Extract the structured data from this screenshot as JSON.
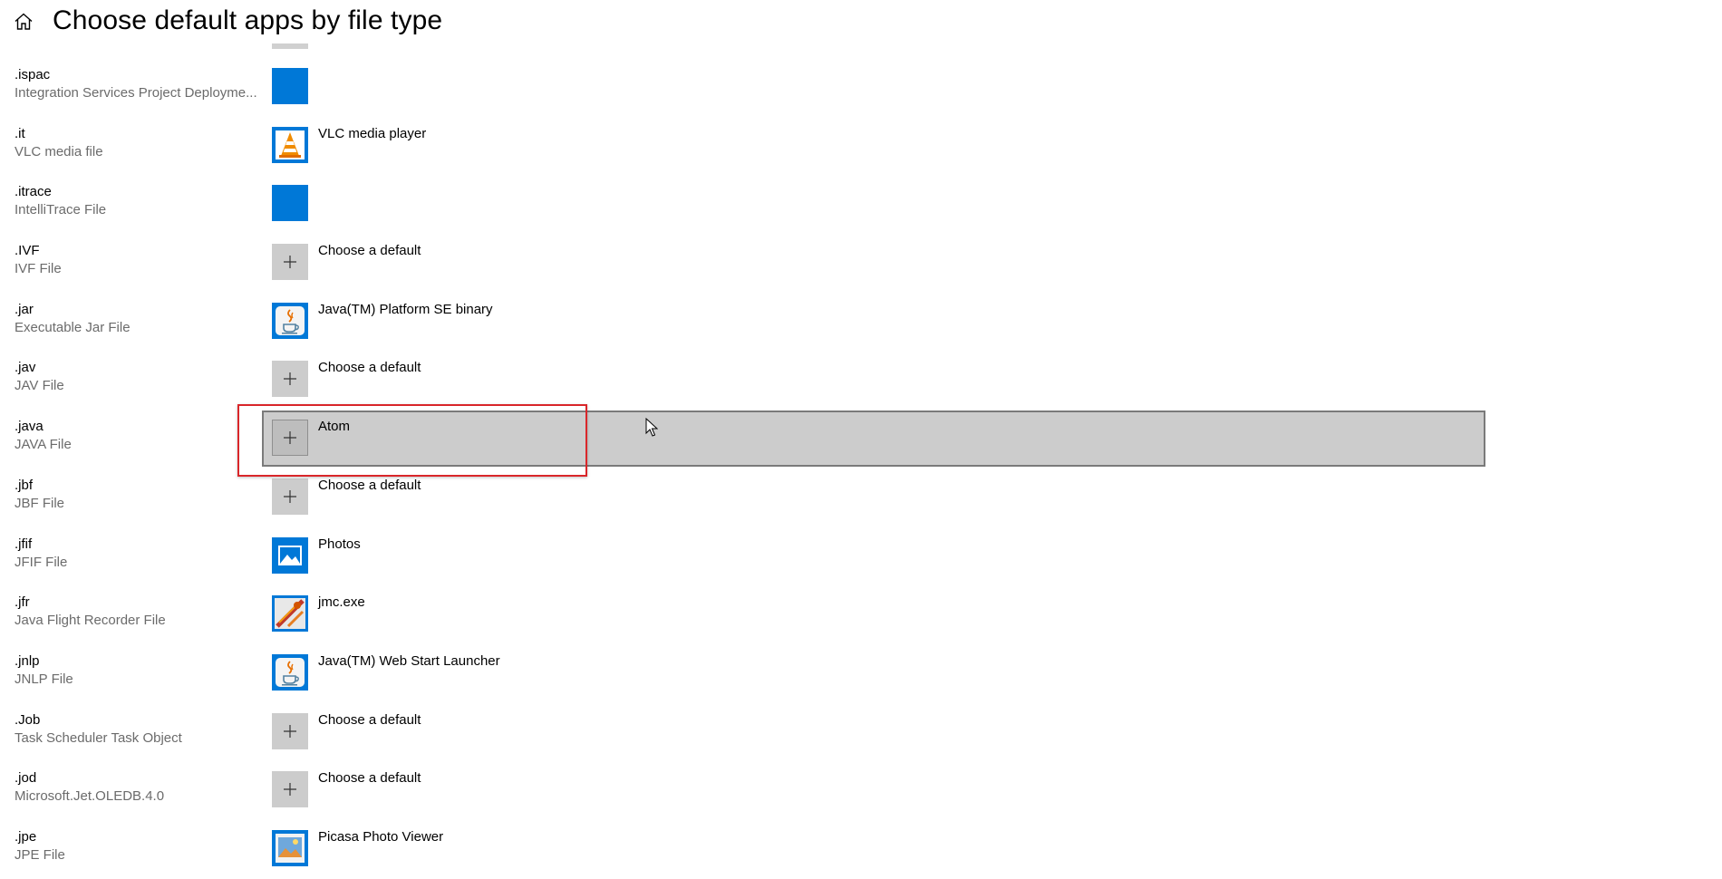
{
  "header": {
    "title": "Choose default apps by file type",
    "home_icon": "home-icon"
  },
  "rows": [
    {
      "ext": ".ispac",
      "desc": "Integration Services Project Deployme...",
      "app_name": "",
      "icon": "blank-app-icon"
    },
    {
      "ext": ".it",
      "desc": "VLC media file",
      "app_name": "VLC media player",
      "icon": "vlc-icon"
    },
    {
      "ext": ".itrace",
      "desc": "IntelliTrace File",
      "app_name": "",
      "icon": "blank-app-icon"
    },
    {
      "ext": ".IVF",
      "desc": "IVF File",
      "app_name": "Choose a default",
      "icon": "plus-icon"
    },
    {
      "ext": ".jar",
      "desc": "Executable Jar File",
      "app_name": "Java(TM) Platform SE binary",
      "icon": "java-icon"
    },
    {
      "ext": ".jav",
      "desc": "JAV File",
      "app_name": "Choose a default",
      "icon": "plus-icon"
    },
    {
      "ext": ".java",
      "desc": "JAVA File",
      "app_name": "Atom",
      "icon": "plus-icon"
    },
    {
      "ext": ".jbf",
      "desc": "JBF File",
      "app_name": "Choose a default",
      "icon": "plus-icon"
    },
    {
      "ext": ".jfif",
      "desc": "JFIF File",
      "app_name": "Photos",
      "icon": "photos-icon"
    },
    {
      "ext": ".jfr",
      "desc": "Java Flight Recorder File",
      "app_name": "jmc.exe",
      "icon": "jmc-icon"
    },
    {
      "ext": ".jnlp",
      "desc": "JNLP File",
      "app_name": "Java(TM) Web Start Launcher",
      "icon": "java-icon"
    },
    {
      "ext": ".Job",
      "desc": "Task Scheduler Task Object",
      "app_name": "Choose a default",
      "icon": "plus-icon"
    },
    {
      "ext": ".jod",
      "desc": "Microsoft.Jet.OLEDB.4.0",
      "app_name": "Choose a default",
      "icon": "plus-icon"
    },
    {
      "ext": ".jpe",
      "desc": "JPE File",
      "app_name": "Picasa Photo Viewer",
      "icon": "picasa-icon"
    }
  ],
  "colors": {
    "accent_blue": "#0078d7",
    "plus_tile": "#cccccc",
    "highlight_red": "#d9262a",
    "secondary_text": "#6b6b6b"
  }
}
